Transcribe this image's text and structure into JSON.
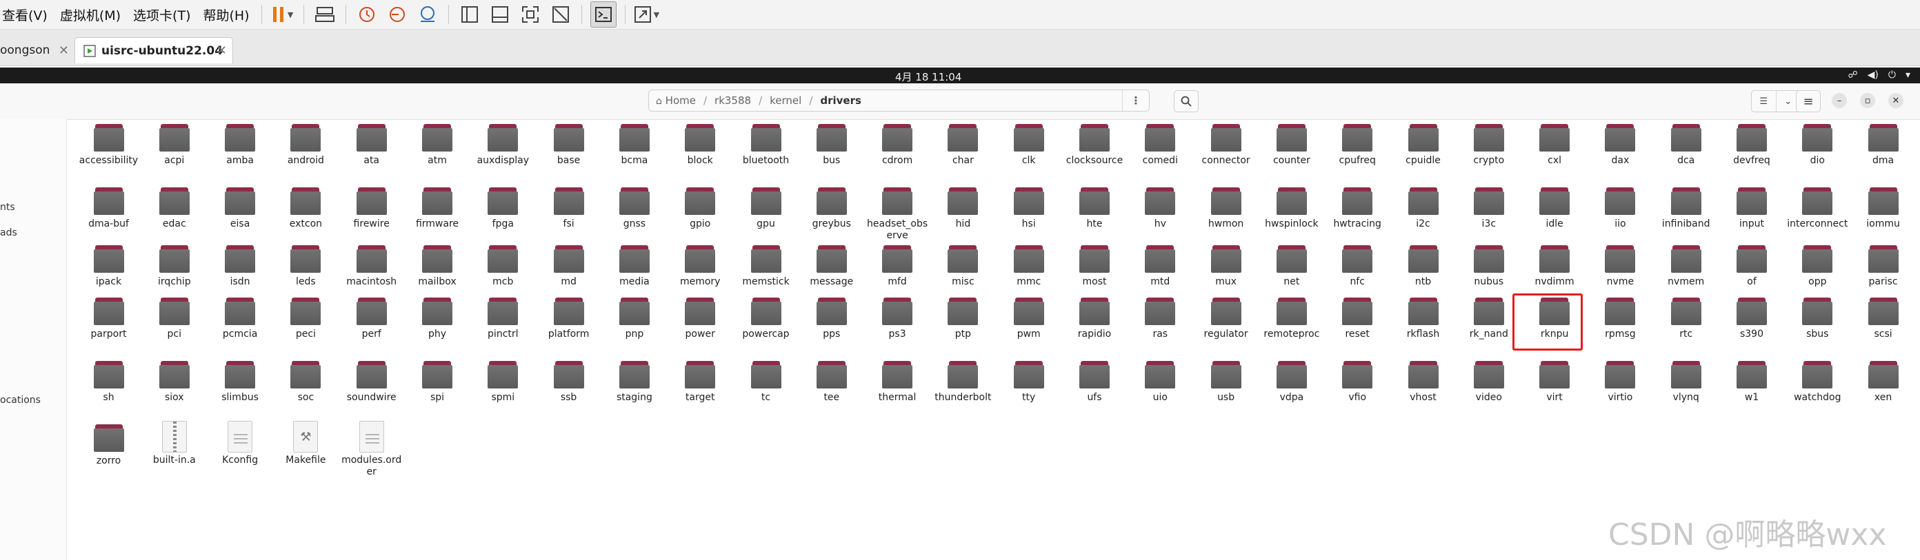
{
  "vm_menubar": {
    "menus": [
      "查看(V)",
      "虚拟机(M)",
      "选项卡(T)",
      "帮助(H)"
    ]
  },
  "tabs": [
    {
      "label": "oongson",
      "active": false
    },
    {
      "label": "uisrc-ubuntu22.04",
      "active": true
    }
  ],
  "top_bar": {
    "clock": "4月 18 11:04"
  },
  "path": {
    "segments": [
      "Home",
      "rk3588",
      "kernel",
      "drivers"
    ]
  },
  "sidebar": {
    "items": [
      "",
      "nts",
      "ads",
      "ocations"
    ]
  },
  "files": [
    "accessibility",
    "acpi",
    "amba",
    "android",
    "ata",
    "atm",
    "auxdisplay",
    "base",
    "bcma",
    "block",
    "bluetooth",
    "bus",
    "cdrom",
    "char",
    "clk",
    "clocksource",
    "comedi",
    "connector",
    "counter",
    "cpufreq",
    "cpuidle",
    "crypto",
    "cxl",
    "dax",
    "dca",
    "devfreq",
    "dio",
    "dma",
    "dma-buf",
    "edac",
    "eisa",
    "extcon",
    "firewire",
    "firmware",
    "fpga",
    "fsi",
    "gnss",
    "gpio",
    "gpu",
    "greybus",
    "headset_observe",
    "hid",
    "hsi",
    "hte",
    "hv",
    "hwmon",
    "hwspinlock",
    "hwtracing",
    "i2c",
    "i3c",
    "idle",
    "iio",
    "infiniband",
    "input",
    "interconnect",
    "iommu",
    "ipack",
    "irqchip",
    "isdn",
    "leds",
    "macintosh",
    "mailbox",
    "mcb",
    "md",
    "media",
    "memory",
    "memstick",
    "message",
    "mfd",
    "misc",
    "mmc",
    "most",
    "mtd",
    "mux",
    "net",
    "nfc",
    "ntb",
    "nubus",
    "nvdimm",
    "nvme",
    "nvmem",
    "of",
    "opp",
    "parisc",
    "parport",
    "pci",
    "pcmcia",
    "peci",
    "perf",
    "phy",
    "pinctrl",
    "platform",
    "pnp",
    "power",
    "powercap",
    "pps",
    "ps3",
    "ptp",
    "pwm",
    "rapidio",
    "ras",
    "regulator",
    "remoteproc",
    "reset",
    "rkflash",
    "rk_nand",
    "rknpu",
    "rpmsg",
    "rtc",
    "s390",
    "sbus",
    "scsi",
    "sh",
    "siox",
    "slimbus",
    "soc",
    "soundwire",
    "spi",
    "spmi",
    "ssb",
    "staging",
    "target",
    "tc",
    "tee",
    "thermal",
    "thunderbolt",
    "tty",
    "ufs",
    "uio",
    "usb",
    "vdpa",
    "vfio",
    "vhost",
    "video",
    "virt",
    "virtio",
    "vlynq",
    "w1",
    "watchdog",
    "xen",
    "zorro",
    "built-in.a",
    "Kconfig",
    "Makefile",
    "modules.order"
  ],
  "file_types": {
    "built-in.a": "archive",
    "Kconfig": "text",
    "Makefile": "makefile",
    "modules.order": "text"
  },
  "highlighted_item": "rknpu",
  "highlight_color": "#e31d1d",
  "folder_colors": {
    "tab": "#8e2c48",
    "body": "#666666"
  },
  "watermark": "CSDN @啊略略wxx"
}
